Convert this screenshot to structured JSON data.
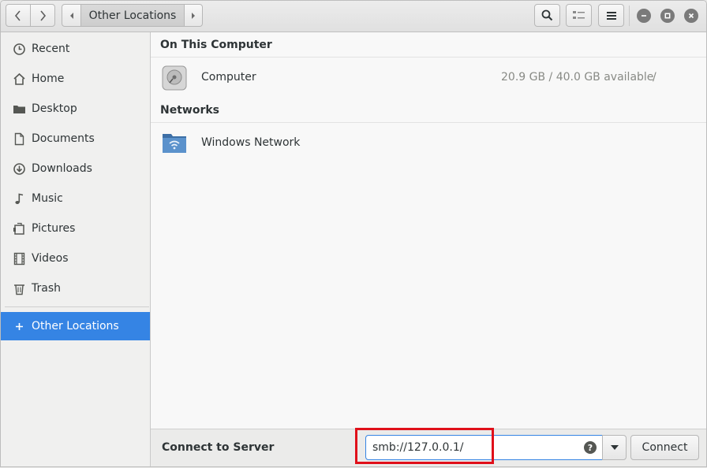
{
  "header": {
    "path_crumb": "Other Locations"
  },
  "sidebar": {
    "items": [
      {
        "label": "Recent",
        "icon": "clock-icon"
      },
      {
        "label": "Home",
        "icon": "home-icon"
      },
      {
        "label": "Desktop",
        "icon": "folder-icon"
      },
      {
        "label": "Documents",
        "icon": "document-icon"
      },
      {
        "label": "Downloads",
        "icon": "download-icon"
      },
      {
        "label": "Music",
        "icon": "music-note-icon"
      },
      {
        "label": "Pictures",
        "icon": "pictures-icon"
      },
      {
        "label": "Videos",
        "icon": "film-icon"
      },
      {
        "label": "Trash",
        "icon": "trash-icon"
      }
    ],
    "other_locations": {
      "label": "Other Locations",
      "icon": "plus-icon"
    }
  },
  "main": {
    "on_this_computer": "On This Computer",
    "computer": {
      "name": "Computer",
      "info": "20.9 GB / 40.0 GB available",
      "path": "/"
    },
    "networks": "Networks",
    "windows_network": {
      "name": "Windows Network"
    }
  },
  "actionbar": {
    "label": "Connect to Server",
    "server_value": "smb://127.0.0.1/",
    "connect_label": "Connect"
  },
  "colors": {
    "accent": "#3584e4",
    "highlight": "#e0101a"
  }
}
